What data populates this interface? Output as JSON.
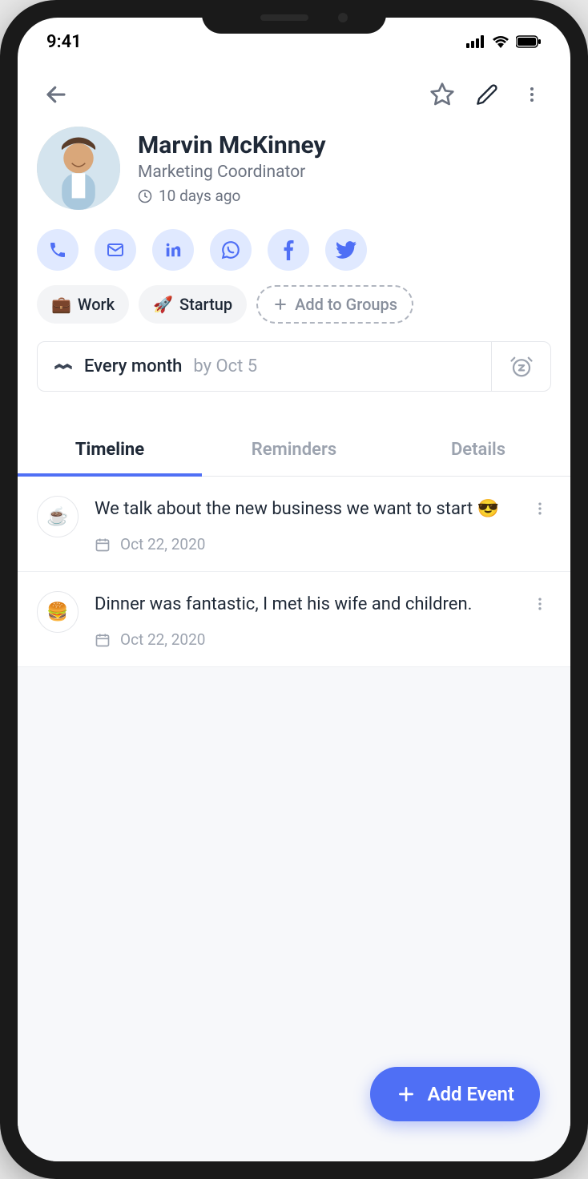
{
  "status": {
    "time": "9:41"
  },
  "profile": {
    "name": "Marvin McKinney",
    "role": "Marketing Coordinator",
    "last_seen": "10 days ago"
  },
  "tags": [
    {
      "emoji": "💼",
      "label": "Work"
    },
    {
      "emoji": "🚀",
      "label": "Startup"
    }
  ],
  "tag_add_label": "Add to Groups",
  "reminder": {
    "frequency": "Every month",
    "by": "by Oct 5"
  },
  "tabs": {
    "timeline": "Timeline",
    "reminders": "Reminders",
    "details": "Details"
  },
  "events": [
    {
      "emoji": "☕",
      "text": "We talk about the new business we want to start 😎",
      "date": "Oct 22, 2020"
    },
    {
      "emoji": "🍔",
      "text": "Dinner was fantastic, I met his wife and children.",
      "date": "Oct 22, 2020"
    }
  ],
  "fab_label": "Add Event"
}
